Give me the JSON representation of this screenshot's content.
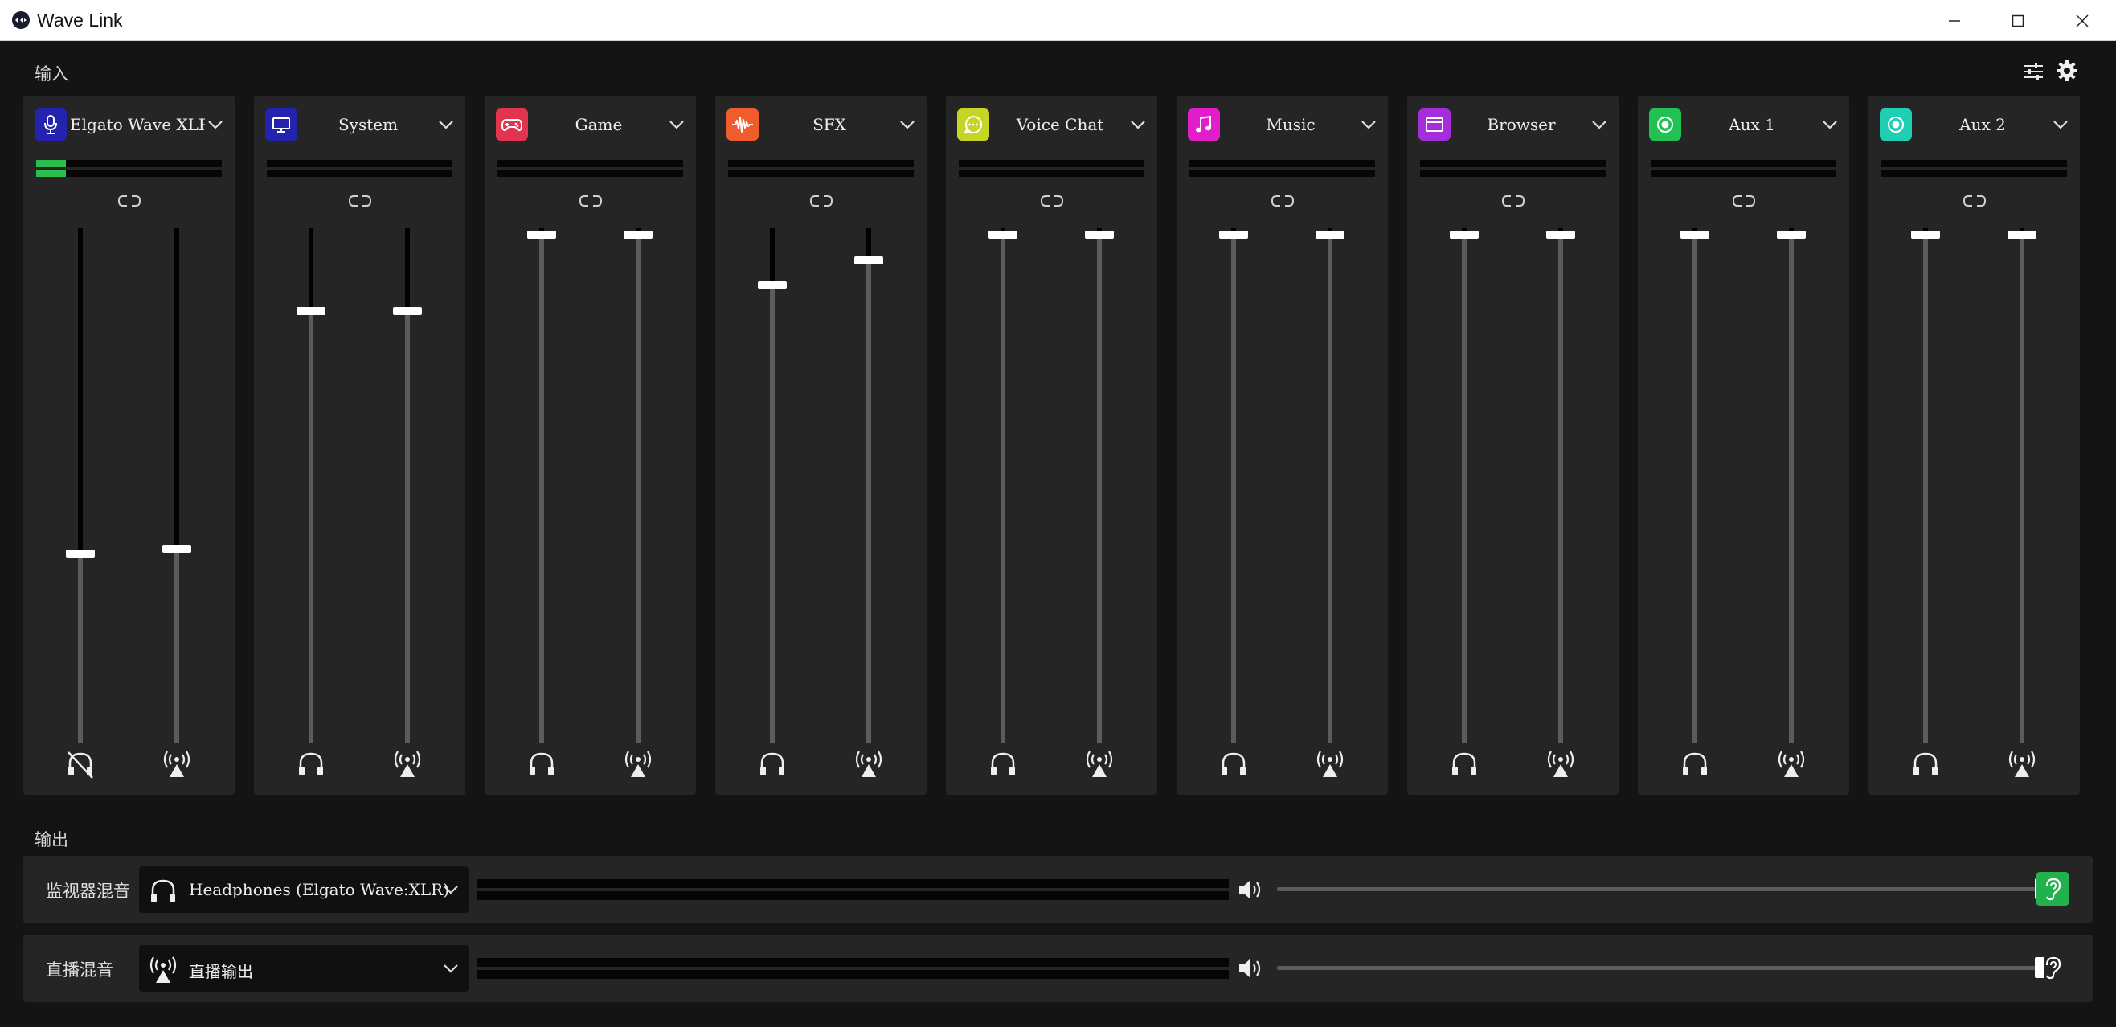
{
  "window": {
    "title": "Wave Link"
  },
  "inputs": {
    "label": "输入",
    "channels": [
      {
        "name": "Elgato Wave XLR",
        "icon": "microphone-icon",
        "color": "#2323b0",
        "meter_level": 0.16,
        "monitor_level": 0.37,
        "stream_level": 0.38,
        "monitor_muted": true
      },
      {
        "name": "System",
        "icon": "monitor-icon",
        "color": "#2323b0",
        "meter_level": 0,
        "monitor_level": 0.85,
        "stream_level": 0.85,
        "monitor_muted": false
      },
      {
        "name": "Game",
        "icon": "gamepad-icon",
        "color": "#e0344f",
        "meter_level": 0,
        "monitor_level": 1.0,
        "stream_level": 1.0,
        "monitor_muted": false
      },
      {
        "name": "SFX",
        "icon": "waveform-icon",
        "color": "#ef5d2c",
        "meter_level": 0,
        "monitor_level": 0.9,
        "stream_level": 0.95,
        "monitor_muted": false
      },
      {
        "name": "Voice Chat",
        "icon": "chat-bubble-icon",
        "color": "#c6d425",
        "meter_level": 0,
        "monitor_level": 1.0,
        "stream_level": 1.0,
        "monitor_muted": false
      },
      {
        "name": "Music",
        "icon": "music-note-icon",
        "color": "#e11ec9",
        "meter_level": 0,
        "monitor_level": 1.0,
        "stream_level": 1.0,
        "monitor_muted": false
      },
      {
        "name": "Browser",
        "icon": "browser-window-icon",
        "color": "#a52ddc",
        "meter_level": 0,
        "monitor_level": 1.0,
        "stream_level": 1.0,
        "monitor_muted": false
      },
      {
        "name": "Aux 1",
        "icon": "aux-circle-icon",
        "color": "#22c154",
        "meter_level": 0,
        "monitor_level": 1.0,
        "stream_level": 1.0,
        "monitor_muted": false
      },
      {
        "name": "Aux 2",
        "icon": "aux-circle-icon",
        "color": "#1fcfb3",
        "meter_level": 0,
        "monitor_level": 1.0,
        "stream_level": 1.0,
        "monitor_muted": false
      }
    ]
  },
  "outputs": {
    "label": "输出",
    "rows": [
      {
        "label": "监视器混音",
        "device": "Headphones (Elgato Wave:XLR)",
        "device_icon": "headphones-icon",
        "volume": 1.0,
        "listen_active": true,
        "listen_color": "#22b14c"
      },
      {
        "label": "直播混音",
        "device": "直播输出",
        "device_icon": "broadcast-icon",
        "volume": 1.0,
        "listen_active": false,
        "listen_color": "#252525"
      }
    ]
  }
}
